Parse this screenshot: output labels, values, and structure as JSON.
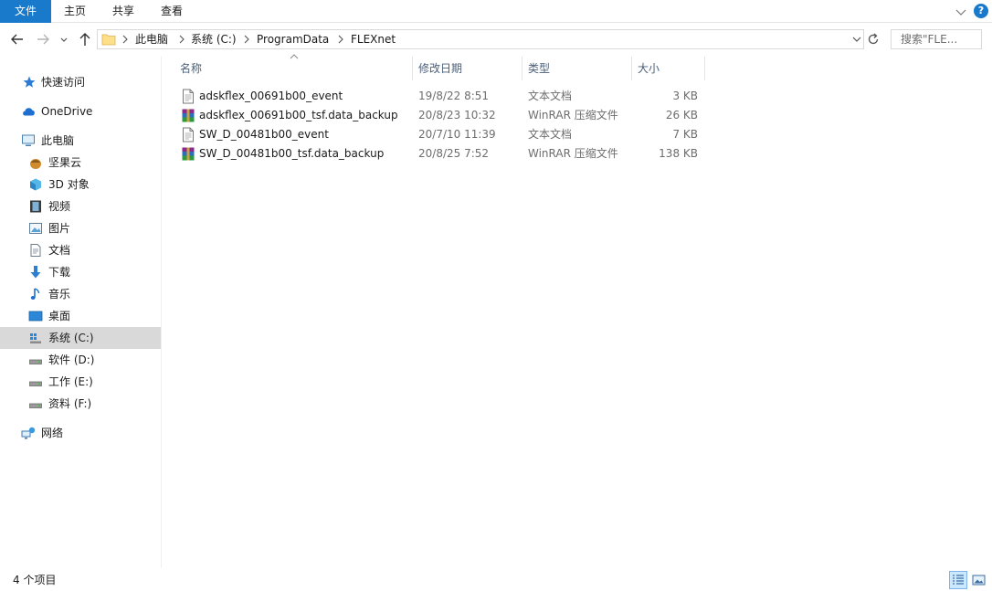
{
  "ribbon": {
    "tabs": [
      "文件",
      "主页",
      "共享",
      "查看"
    ],
    "help": "?"
  },
  "address": {
    "crumbs": [
      "此电脑",
      "系统 (C:)",
      "ProgramData",
      "FLEXnet"
    ],
    "search_placeholder": "搜索\"FLE..."
  },
  "sidebar": {
    "quick_access": "快速访问",
    "onedrive": "OneDrive",
    "this_pc": "此电脑",
    "items": [
      "坚果云",
      "3D 对象",
      "视频",
      "图片",
      "文档",
      "下载",
      "音乐",
      "桌面",
      "系统 (C:)",
      "软件 (D:)",
      "工作 (E:)",
      "资料 (F:)"
    ],
    "network": "网络"
  },
  "columns": {
    "name": "名称",
    "date": "修改日期",
    "type": "类型",
    "size": "大小"
  },
  "files": [
    {
      "name": "adskflex_00691b00_event",
      "date": "19/8/22 8:51",
      "type": "文本文档",
      "size": "3 KB",
      "icon": "text-file-icon"
    },
    {
      "name": "adskflex_00691b00_tsf.data_backup",
      "date": "20/8/23 10:32",
      "type": "WinRAR 压缩文件",
      "size": "26 KB",
      "icon": "winrar-icon"
    },
    {
      "name": "SW_D_00481b00_event",
      "date": "20/7/10 11:39",
      "type": "文本文档",
      "size": "7 KB",
      "icon": "text-file-icon"
    },
    {
      "name": "SW_D_00481b00_tsf.data_backup",
      "date": "20/8/25 7:52",
      "type": "WinRAR 压缩文件",
      "size": "138 KB",
      "icon": "winrar-icon"
    }
  ],
  "status": {
    "count": "4 个项目"
  },
  "colors": {
    "accent": "#1979ca",
    "selected_bg": "#d9d9d9",
    "header_text": "#4c607a"
  }
}
